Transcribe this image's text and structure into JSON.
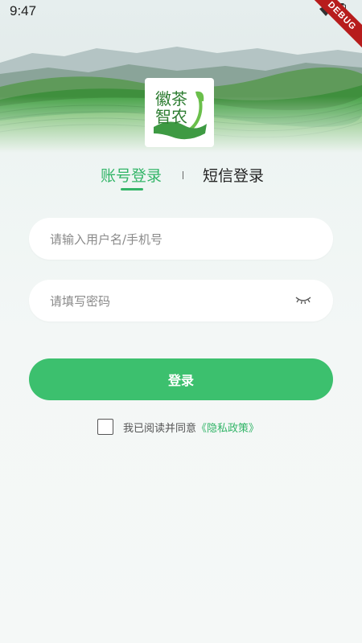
{
  "status_bar": {
    "time": "9:47",
    "debug_label": "DEBUG"
  },
  "logo": {
    "line1": "徽茶",
    "line2": "智农"
  },
  "tabs": [
    {
      "label": "账号登录",
      "active": true
    },
    {
      "label": "短信登录",
      "active": false
    }
  ],
  "form": {
    "username_placeholder": "请输入用户名/手机号",
    "password_placeholder": "请填写密码",
    "login_label": "登录"
  },
  "agreement": {
    "text": "我已阅读并同意",
    "link": "《隐私政策》",
    "checked": false
  },
  "colors": {
    "accent": "#33b568",
    "button": "#3cc06e"
  }
}
